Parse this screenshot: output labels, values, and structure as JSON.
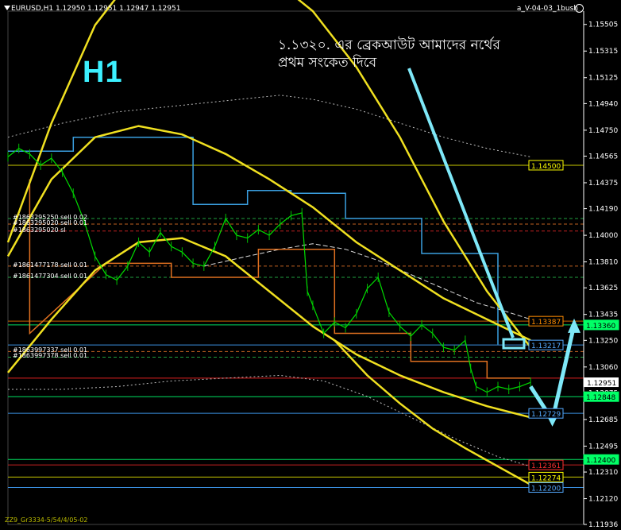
{
  "header": {
    "symbol_info": "EURUSD,H1  1.12950 1.12951 1.12947 1.12951",
    "indicator_info": "a_V-04-03_1bush"
  },
  "timeframe_label": "H1",
  "annotation": {
    "line1": "১.১৩২০. এর ব্রেকআউট আমাদের নর্থের",
    "line2": "প্রথম সংকেত দিবে"
  },
  "bottom_label": "ZZ9_Gr3334-5/54/4/05-02",
  "orders": [
    {
      "label": "#1863295250 sell 0.02",
      "y": 1.1412
    },
    {
      "label": "#1863295020 sell 0.01",
      "y": 1.1408
    },
    {
      "label": "#1863295020 sl",
      "y": 1.1403
    },
    {
      "label": "#1861477178 sell 0.01",
      "y": 1.1378
    },
    {
      "label": "#1861477304 sell 0.01",
      "y": 1.137
    },
    {
      "label": "#1863997337 sell 0.01",
      "y": 1.1317
    },
    {
      "label": "#1863997378 sell 0.01",
      "y": 1.1313
    }
  ],
  "chart_data": {
    "type": "line",
    "title": "EURUSD,H1",
    "ylim": [
      1.11936,
      1.156
    ],
    "price_ticks": [
      "1.15505",
      "1.15315",
      "1.15125",
      "1.14940",
      "1.14750",
      "1.14565",
      "1.14375",
      "1.14190",
      "1.14000",
      "1.13810",
      "1.13625",
      "1.13435",
      "1.13250",
      "1.13060",
      "1.12875",
      "1.12685",
      "1.12495",
      "1.12310",
      "1.12120",
      "1.11936"
    ],
    "current_price": "1.12951",
    "level_labels": [
      {
        "text": "1.14500",
        "value": 1.145,
        "color": "#ffff00"
      },
      {
        "text": "1.13387",
        "value": 1.13387,
        "color": "#ff8c00"
      },
      {
        "text": "1.13360",
        "value": 1.1336,
        "color": "#00ff66",
        "filled": true
      },
      {
        "text": "1.13217",
        "value": 1.13217,
        "color": "#55aaff"
      },
      {
        "text": "1.12848",
        "value": 1.12848,
        "color": "#00ff66",
        "filled": true
      },
      {
        "text": "1.12729",
        "value": 1.12729,
        "color": "#55aaff"
      },
      {
        "text": "1.12400",
        "value": 1.124,
        "color": "#00ff66",
        "filled": true
      },
      {
        "text": "1.12361",
        "value": 1.12361,
        "color": "#ff3030"
      },
      {
        "text": "1.12274",
        "value": 1.12274,
        "color": "#ffff00"
      },
      {
        "text": "1.12200",
        "value": 1.122,
        "color": "#55aaff"
      }
    ],
    "horizontal_levels": [
      {
        "value": 1.145,
        "color": "#c8c800",
        "style": "solid"
      },
      {
        "value": 1.13387,
        "color": "#c86400",
        "style": "solid"
      },
      {
        "value": 1.1336,
        "color": "#00e060",
        "style": "solid"
      },
      {
        "value": 1.13217,
        "color": "#3a8fe0",
        "style": "solid"
      },
      {
        "value": 1.1298,
        "color": "#e02020",
        "style": "solid"
      },
      {
        "value": 1.12848,
        "color": "#00e060",
        "style": "solid"
      },
      {
        "value": 1.12729,
        "color": "#3a8fe0",
        "style": "solid"
      },
      {
        "value": 1.124,
        "color": "#00e060",
        "style": "solid"
      },
      {
        "value": 1.12361,
        "color": "#c02020",
        "style": "solid"
      },
      {
        "value": 1.12274,
        "color": "#c8c800",
        "style": "solid"
      },
      {
        "value": 1.122,
        "color": "#3a8fe0",
        "style": "solid"
      },
      {
        "value": 1.1412,
        "color": "#20a040",
        "style": "dash"
      },
      {
        "value": 1.1408,
        "color": "#c06020",
        "style": "dash"
      },
      {
        "value": 1.1403,
        "color": "#c02020",
        "style": "dash"
      },
      {
        "value": 1.1378,
        "color": "#c06020",
        "style": "dash"
      },
      {
        "value": 1.137,
        "color": "#20a040",
        "style": "dash"
      },
      {
        "value": 1.1317,
        "color": "#c06020",
        "style": "dash"
      },
      {
        "value": 1.1313,
        "color": "#20a040",
        "style": "dash"
      }
    ],
    "bands": {
      "upper_outer": [
        [
          0,
          1.1395
        ],
        [
          8,
          1.148
        ],
        [
          16,
          1.155
        ],
        [
          24,
          1.159
        ],
        [
          32,
          1.16
        ],
        [
          40,
          1.1598
        ],
        [
          48,
          1.1585
        ],
        [
          56,
          1.156
        ],
        [
          64,
          1.152
        ],
        [
          72,
          1.147
        ],
        [
          80,
          1.141
        ],
        [
          88,
          1.136
        ],
        [
          96,
          1.132
        ]
      ],
      "upper_inner": [
        [
          0,
          1.1385
        ],
        [
          8,
          1.144
        ],
        [
          16,
          1.147
        ],
        [
          24,
          1.1478
        ],
        [
          32,
          1.1472
        ],
        [
          40,
          1.1458
        ],
        [
          48,
          1.144
        ],
        [
          56,
          1.142
        ],
        [
          64,
          1.1395
        ],
        [
          72,
          1.1375
        ],
        [
          80,
          1.1355
        ],
        [
          88,
          1.134
        ],
        [
          96,
          1.1325
        ]
      ],
      "lower_inner": [
        [
          0,
          1.1302
        ],
        [
          8,
          1.134
        ],
        [
          16,
          1.1375
        ],
        [
          24,
          1.1395
        ],
        [
          32,
          1.1398
        ],
        [
          40,
          1.1385
        ],
        [
          48,
          1.136
        ],
        [
          56,
          1.1335
        ],
        [
          64,
          1.1315
        ],
        [
          72,
          1.13
        ],
        [
          80,
          1.1288
        ],
        [
          88,
          1.1278
        ],
        [
          96,
          1.127
        ]
      ],
      "lower_outer": [
        [
          60,
          1.1325
        ],
        [
          66,
          1.13
        ],
        [
          72,
          1.128
        ],
        [
          78,
          1.1262
        ],
        [
          84,
          1.1248
        ],
        [
          90,
          1.1235
        ],
        [
          96,
          1.1222
        ]
      ],
      "dotted_upper": [
        [
          0,
          1.147
        ],
        [
          10,
          1.148
        ],
        [
          20,
          1.1488
        ],
        [
          30,
          1.1492
        ],
        [
          40,
          1.1496
        ],
        [
          50,
          1.15
        ],
        [
          56,
          1.1497
        ],
        [
          64,
          1.149
        ],
        [
          72,
          1.148
        ],
        [
          80,
          1.147
        ],
        [
          88,
          1.1462
        ],
        [
          96,
          1.1456
        ]
      ],
      "dotted_lower": [
        [
          0,
          1.129
        ],
        [
          10,
          1.129
        ],
        [
          20,
          1.1292
        ],
        [
          30,
          1.1296
        ],
        [
          40,
          1.1298
        ],
        [
          50,
          1.13
        ],
        [
          58,
          1.1296
        ],
        [
          66,
          1.1285
        ],
        [
          74,
          1.127
        ],
        [
          82,
          1.1255
        ],
        [
          90,
          1.1242
        ],
        [
          96,
          1.1235
        ]
      ],
      "white_ma": [
        [
          36,
          1.1378
        ],
        [
          44,
          1.1385
        ],
        [
          50,
          1.139
        ],
        [
          56,
          1.1394
        ],
        [
          62,
          1.139
        ],
        [
          68,
          1.1382
        ],
        [
          74,
          1.1372
        ],
        [
          80,
          1.1362
        ],
        [
          86,
          1.1352
        ],
        [
          92,
          1.1345
        ],
        [
          96,
          1.134
        ]
      ]
    },
    "step_channel_blue": [
      [
        0,
        1.146
      ],
      [
        12,
        1.146
      ],
      [
        12,
        1.147
      ],
      [
        24,
        1.147
      ],
      [
        24,
        1.147
      ],
      [
        34,
        1.147
      ],
      [
        34,
        1.1422
      ],
      [
        44,
        1.1422
      ],
      [
        44,
        1.1432
      ],
      [
        52,
        1.1432
      ],
      [
        52,
        1.143
      ],
      [
        62,
        1.143
      ],
      [
        62,
        1.1412
      ],
      [
        76,
        1.1412
      ],
      [
        76,
        1.1387
      ],
      [
        90,
        1.1387
      ],
      [
        90,
        1.1322
      ]
    ],
    "step_channel_orange": [
      [
        4,
        1.144
      ],
      [
        4,
        1.133
      ],
      [
        18,
        1.138
      ],
      [
        30,
        1.138
      ],
      [
        30,
        1.137
      ],
      [
        46,
        1.137
      ],
      [
        46,
        1.139
      ],
      [
        60,
        1.139
      ],
      [
        60,
        1.133
      ],
      [
        74,
        1.133
      ],
      [
        74,
        1.131
      ],
      [
        88,
        1.131
      ],
      [
        88,
        1.1298
      ],
      [
        96,
        1.1298
      ]
    ],
    "price": [
      [
        0,
        1.1456
      ],
      [
        2,
        1.1462
      ],
      [
        4,
        1.1458
      ],
      [
        6,
        1.145
      ],
      [
        8,
        1.1455
      ],
      [
        10,
        1.1445
      ],
      [
        12,
        1.143
      ],
      [
        14,
        1.141
      ],
      [
        16,
        1.1385
      ],
      [
        18,
        1.1372
      ],
      [
        20,
        1.1368
      ],
      [
        22,
        1.1378
      ],
      [
        24,
        1.1395
      ],
      [
        26,
        1.1388
      ],
      [
        28,
        1.1402
      ],
      [
        30,
        1.1392
      ],
      [
        32,
        1.1388
      ],
      [
        34,
        1.138
      ],
      [
        36,
        1.1378
      ],
      [
        38,
        1.1392
      ],
      [
        40,
        1.1412
      ],
      [
        42,
        1.14
      ],
      [
        44,
        1.1398
      ],
      [
        46,
        1.1404
      ],
      [
        48,
        1.14
      ],
      [
        50,
        1.1408
      ],
      [
        52,
        1.1414
      ],
      [
        54,
        1.1416
      ],
      [
        55,
        1.136
      ],
      [
        56,
        1.135
      ],
      [
        58,
        1.133
      ],
      [
        60,
        1.1338
      ],
      [
        62,
        1.1334
      ],
      [
        64,
        1.1344
      ],
      [
        66,
        1.1362
      ],
      [
        68,
        1.137
      ],
      [
        70,
        1.1345
      ],
      [
        72,
        1.1335
      ],
      [
        74,
        1.1328
      ],
      [
        76,
        1.1336
      ],
      [
        78,
        1.133
      ],
      [
        80,
        1.132
      ],
      [
        82,
        1.1318
      ],
      [
        84,
        1.1325
      ],
      [
        85,
        1.1305
      ],
      [
        86,
        1.1292
      ],
      [
        88,
        1.1288
      ],
      [
        90,
        1.1292
      ],
      [
        92,
        1.129
      ],
      [
        94,
        1.1292
      ],
      [
        96,
        1.1295
      ]
    ],
    "forecast": [
      [
        96,
        1.1292
      ],
      [
        100,
        1.1268
      ],
      [
        104,
        1.1336
      ]
    ]
  }
}
